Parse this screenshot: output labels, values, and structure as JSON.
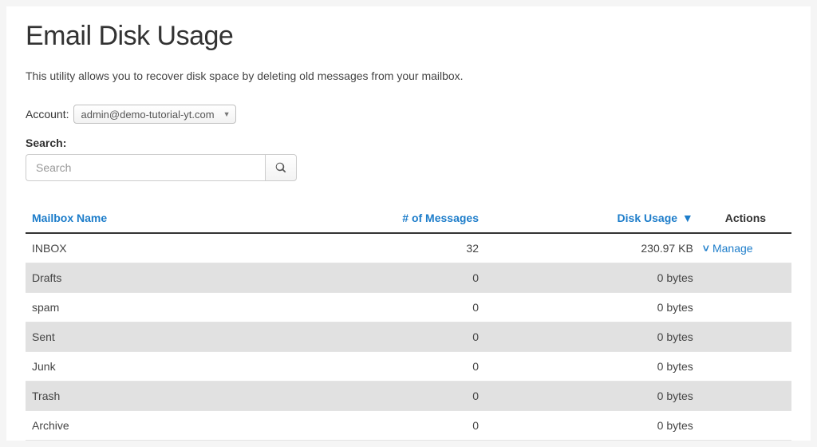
{
  "page_title": "Email Disk Usage",
  "description": "This utility allows you to recover disk space by deleting old messages from your mailbox.",
  "account": {
    "label": "Account:",
    "selected": "admin@demo-tutorial-yt.com"
  },
  "search": {
    "label": "Search:",
    "value": "",
    "placeholder": "Search"
  },
  "table": {
    "columns": {
      "name": "Mailbox Name",
      "messages": "# of Messages",
      "usage": "Disk Usage",
      "actions": "Actions"
    },
    "sort_indicator": "▼",
    "rows": [
      {
        "name": "INBOX",
        "messages": "32",
        "usage": "230.97 KB",
        "manage": "Manage"
      },
      {
        "name": "Drafts",
        "messages": "0",
        "usage": "0 bytes",
        "manage": ""
      },
      {
        "name": "spam",
        "messages": "0",
        "usage": "0 bytes",
        "manage": ""
      },
      {
        "name": "Sent",
        "messages": "0",
        "usage": "0 bytes",
        "manage": ""
      },
      {
        "name": "Junk",
        "messages": "0",
        "usage": "0 bytes",
        "manage": ""
      },
      {
        "name": "Trash",
        "messages": "0",
        "usage": "0 bytes",
        "manage": ""
      },
      {
        "name": "Archive",
        "messages": "0",
        "usage": "0 bytes",
        "manage": ""
      }
    ]
  },
  "colors": {
    "link": "#1d7dca",
    "alt_row": "#e1e1e1"
  }
}
